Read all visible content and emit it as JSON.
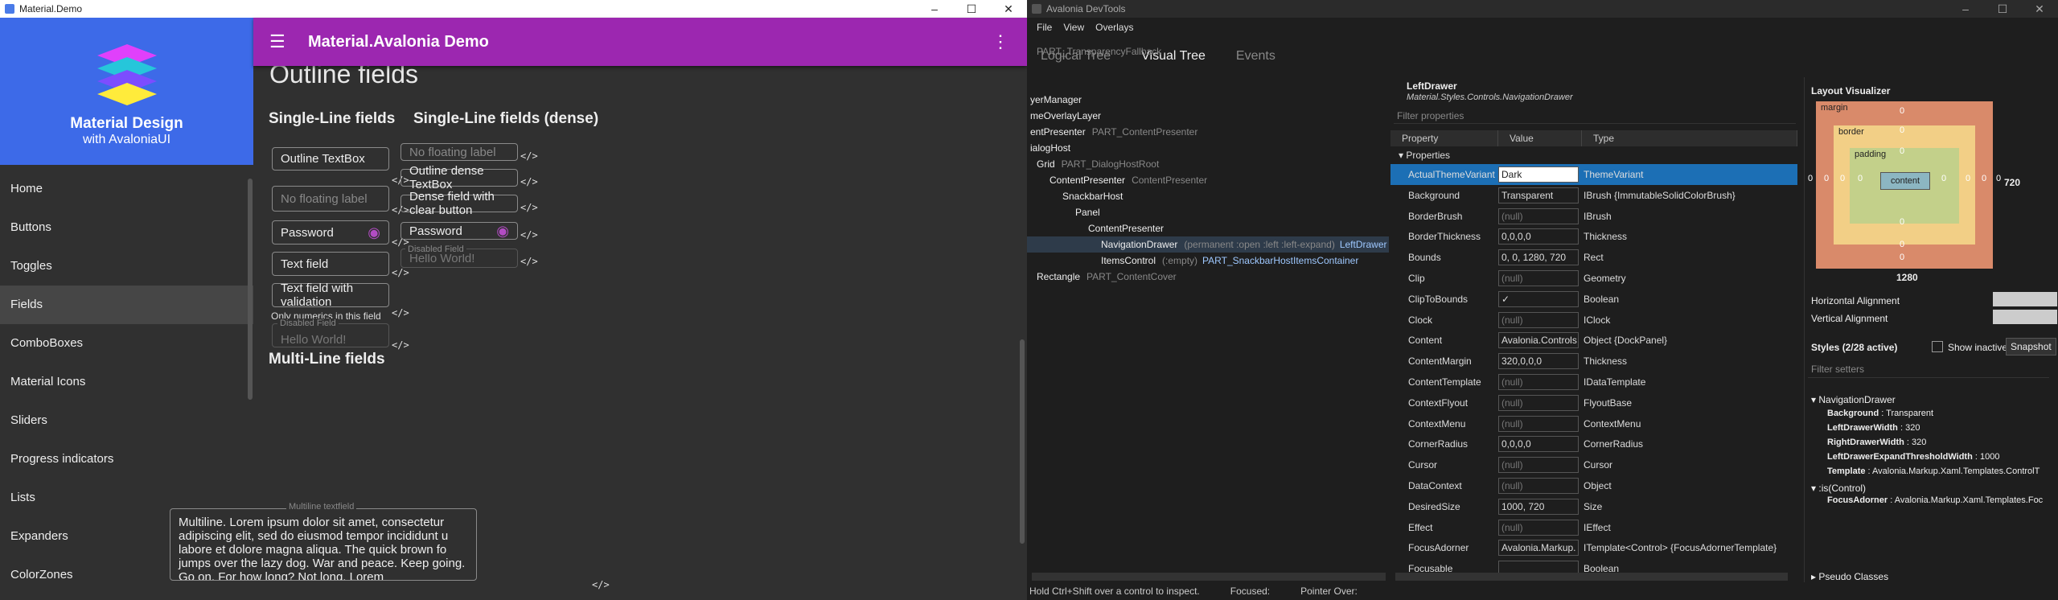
{
  "demo_window": {
    "title": "Material.Demo",
    "controls": [
      "–",
      "☐",
      "✕"
    ],
    "drawer": {
      "title": "Material Design",
      "subtitle": "with AvaloniaUI",
      "items": [
        "Home",
        "Buttons",
        "Toggles",
        "Fields",
        "ComboBoxes",
        "Material Icons",
        "Sliders",
        "Progress indicators",
        "Lists",
        "Expanders",
        "ColorZones"
      ],
      "selected": "Fields"
    },
    "appbar": {
      "title": "Material.Avalonia Demo",
      "menu_icon": "hamburger-icon",
      "more_icon": "kebab-icon",
      "color": "#9c27b0"
    },
    "page_title": "Outline fields",
    "single_line": {
      "heading": "Single-Line fields",
      "fields": [
        {
          "text": "Outline TextBox"
        },
        {
          "text": "No floating label"
        },
        {
          "text": "Password"
        },
        {
          "text": "Text field"
        },
        {
          "text": "Text field with validation"
        }
      ],
      "helper": "Only numerics in this field",
      "disabled_label": "Disabled Field",
      "disabled_value": "Hello World!"
    },
    "single_line_dense": {
      "heading": "Single-Line fields (dense)",
      "fields": [
        {
          "text": "No floating label"
        },
        {
          "text": "Outline dense TextBox"
        },
        {
          "text": "Dense field with clear button"
        },
        {
          "text": "Password"
        }
      ],
      "disabled_label": "Disabled Field",
      "disabled_value": "Hello World!"
    },
    "multi_line": {
      "heading": "Multi-Line fields",
      "label": "Multiline textfield",
      "text": "Multiline. Lorem ipsum dolor sit amet, consectetur adipiscing elit, sed do eiusmod tempor incididunt u labore  et dolore magna aliqua. The quick brown fo jumps over the   lazy dog. War and peace. Keep going. Go on. For how long?  Not long. Lorem"
    },
    "code_glyph": "</>"
  },
  "devtools_window": {
    "title": "Avalonia DevTools",
    "controls": [
      "–",
      "☐",
      "✕"
    ],
    "menu": [
      "File",
      "View",
      "Overlays"
    ],
    "tabs": [
      "Logical Tree",
      "Visual Tree",
      "Events"
    ],
    "selected_tab": "Visual Tree",
    "tree": [
      {
        "name": "PART_TransparencyFallback",
        "part": true,
        "indent": 0,
        "top": 0
      },
      {
        "name": "yerManager",
        "indent": 0
      },
      {
        "name": "meOverlayLayer",
        "indent": 0
      },
      {
        "name": "entPresenter",
        "part": "PART_ContentPresenter",
        "indent": 0
      },
      {
        "name": "ialogHost",
        "indent": 0
      },
      {
        "name": "Grid",
        "part": "PART_DialogHostRoot",
        "indent": 1
      },
      {
        "name": "ContentPresenter",
        "part": "ContentPresenter",
        "indent": 2
      },
      {
        "name": "SnackbarHost",
        "indent": 3
      },
      {
        "name": "Panel",
        "indent": 4
      },
      {
        "name": "ContentPresenter",
        "indent": 5
      },
      {
        "name": "NavigationDrawer",
        "part": "(permanent :open :left :left-expand)",
        "cls": "LeftDrawer",
        "indent": 6,
        "selected": true
      },
      {
        "name": "ItemsControl",
        "part": "(:empty)",
        "cls": "PART_SnackbarHostItemsContainer",
        "indent": 6
      },
      {
        "name": "Rectangle",
        "part": "PART_ContentCover",
        "indent": 1
      }
    ],
    "props": {
      "title": "LeftDrawer",
      "type": "Material.Styles.Controls.NavigationDrawer",
      "filter_placeholder": "Filter properties",
      "columns": [
        "Property",
        "Value",
        "Type"
      ],
      "group": "Properties",
      "rows": [
        {
          "name": "ActualThemeVariant",
          "value": "Dark",
          "type": "ThemeVariant",
          "selected": true
        },
        {
          "name": "Background",
          "value": "Transparent",
          "type": "IBrush {ImmutableSolidColorBrush}"
        },
        {
          "name": "BorderBrush",
          "value": "(null)",
          "type": "IBrush"
        },
        {
          "name": "BorderThickness",
          "value": "0,0,0,0",
          "type": "Thickness"
        },
        {
          "name": "Bounds",
          "value": "0, 0, 1280, 720",
          "type": "Rect"
        },
        {
          "name": "Clip",
          "value": "(null)",
          "type": "Geometry"
        },
        {
          "name": "ClipToBounds",
          "value": "✓",
          "type": "Boolean"
        },
        {
          "name": "Clock",
          "value": "(null)",
          "type": "IClock"
        },
        {
          "name": "Content",
          "value": "Avalonia.Controls",
          "type": "Object {DockPanel}"
        },
        {
          "name": "ContentMargin",
          "value": "320,0,0,0",
          "type": "Thickness"
        },
        {
          "name": "ContentTemplate",
          "value": "(null)",
          "type": "IDataTemplate"
        },
        {
          "name": "ContextFlyout",
          "value": "(null)",
          "type": "FlyoutBase"
        },
        {
          "name": "ContextMenu",
          "value": "(null)",
          "type": "ContextMenu"
        },
        {
          "name": "CornerRadius",
          "value": "0,0,0,0",
          "type": "CornerRadius"
        },
        {
          "name": "Cursor",
          "value": "(null)",
          "type": "Cursor"
        },
        {
          "name": "DataContext",
          "value": "(null)",
          "type": "Object"
        },
        {
          "name": "DesiredSize",
          "value": "1000, 720",
          "type": "Size"
        },
        {
          "name": "Effect",
          "value": "(null)",
          "type": "IEffect"
        },
        {
          "name": "FocusAdorner",
          "value": "Avalonia.Markup.",
          "type": "ITemplate<Control> {FocusAdornerTemplate}"
        },
        {
          "name": "Focusable",
          "value": "",
          "type": "Boolean"
        }
      ]
    },
    "layout": {
      "title": "Layout Visualizer",
      "margin_label": "margin",
      "border_label": "border",
      "padding_label": "padding",
      "content_label": "content",
      "zero": "0",
      "width": "1280",
      "height": "720",
      "h_align": "Horizontal Alignment",
      "v_align": "Vertical Alignment",
      "styles_header": "Styles (2/28 active)",
      "show_inactive": "Show inactive",
      "snapshot": "Snapshot",
      "filter_setters": "Filter setters",
      "style1": "NavigationDrawer",
      "setters": [
        {
          "k": "Background",
          "v": "Transparent"
        },
        {
          "k": "LeftDrawerWidth",
          "v": "320"
        },
        {
          "k": "RightDrawerWidth",
          "v": "320"
        },
        {
          "k": "LeftDrawerExpandThresholdWidth",
          "v": "1000"
        },
        {
          "k": "Template",
          "v": "Avalonia.Markup.Xaml.Templates.ControlT"
        }
      ],
      "style2": ":is(Control)",
      "setter2": {
        "k": "FocusAdorner",
        "v": "Avalonia.Markup.Xaml.Templates.Foc"
      },
      "pseudo": "Pseudo Classes"
    },
    "status": [
      "Hold Ctrl+Shift over a control to inspect.",
      "Focused:",
      "Pointer Over:"
    ]
  }
}
